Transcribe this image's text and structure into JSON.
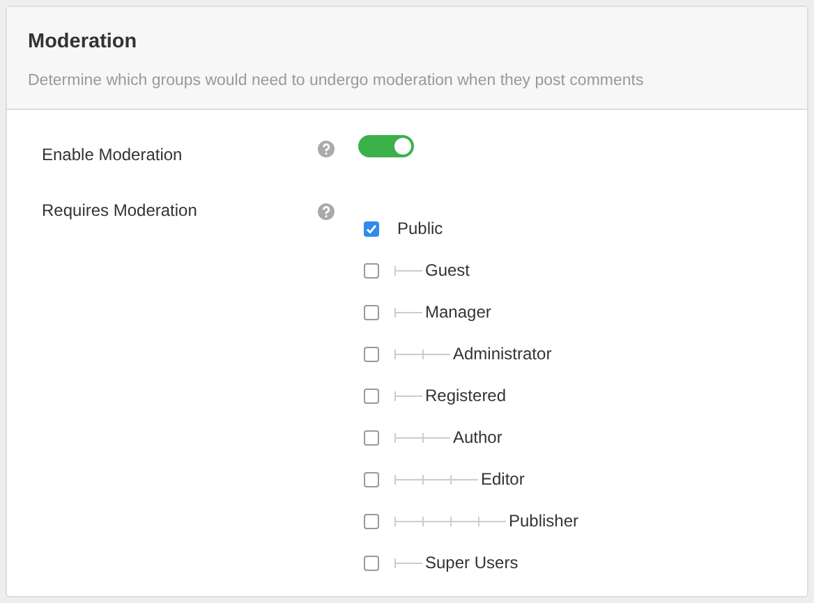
{
  "header": {
    "title": "Moderation",
    "description": "Determine which groups would need to undergo moderation when they post comments"
  },
  "settings": [
    {
      "kind": "toggle",
      "label": "Enable Moderation",
      "on": true
    },
    {
      "kind": "tree",
      "label": "Requires Moderation",
      "groups": [
        {
          "label": "Public",
          "checked": true,
          "children": [
            {
              "label": "Guest",
              "checked": false
            },
            {
              "label": "Manager",
              "checked": false,
              "children": [
                {
                  "label": "Administrator",
                  "checked": false
                }
              ]
            },
            {
              "label": "Registered",
              "checked": false,
              "children": [
                {
                  "label": "Author",
                  "checked": false,
                  "children": [
                    {
                      "label": "Editor",
                      "checked": false,
                      "children": [
                        {
                          "label": "Publisher",
                          "checked": false
                        }
                      ]
                    }
                  ]
                }
              ]
            },
            {
              "label": "Super Users",
              "checked": false
            }
          ]
        }
      ]
    }
  ]
}
